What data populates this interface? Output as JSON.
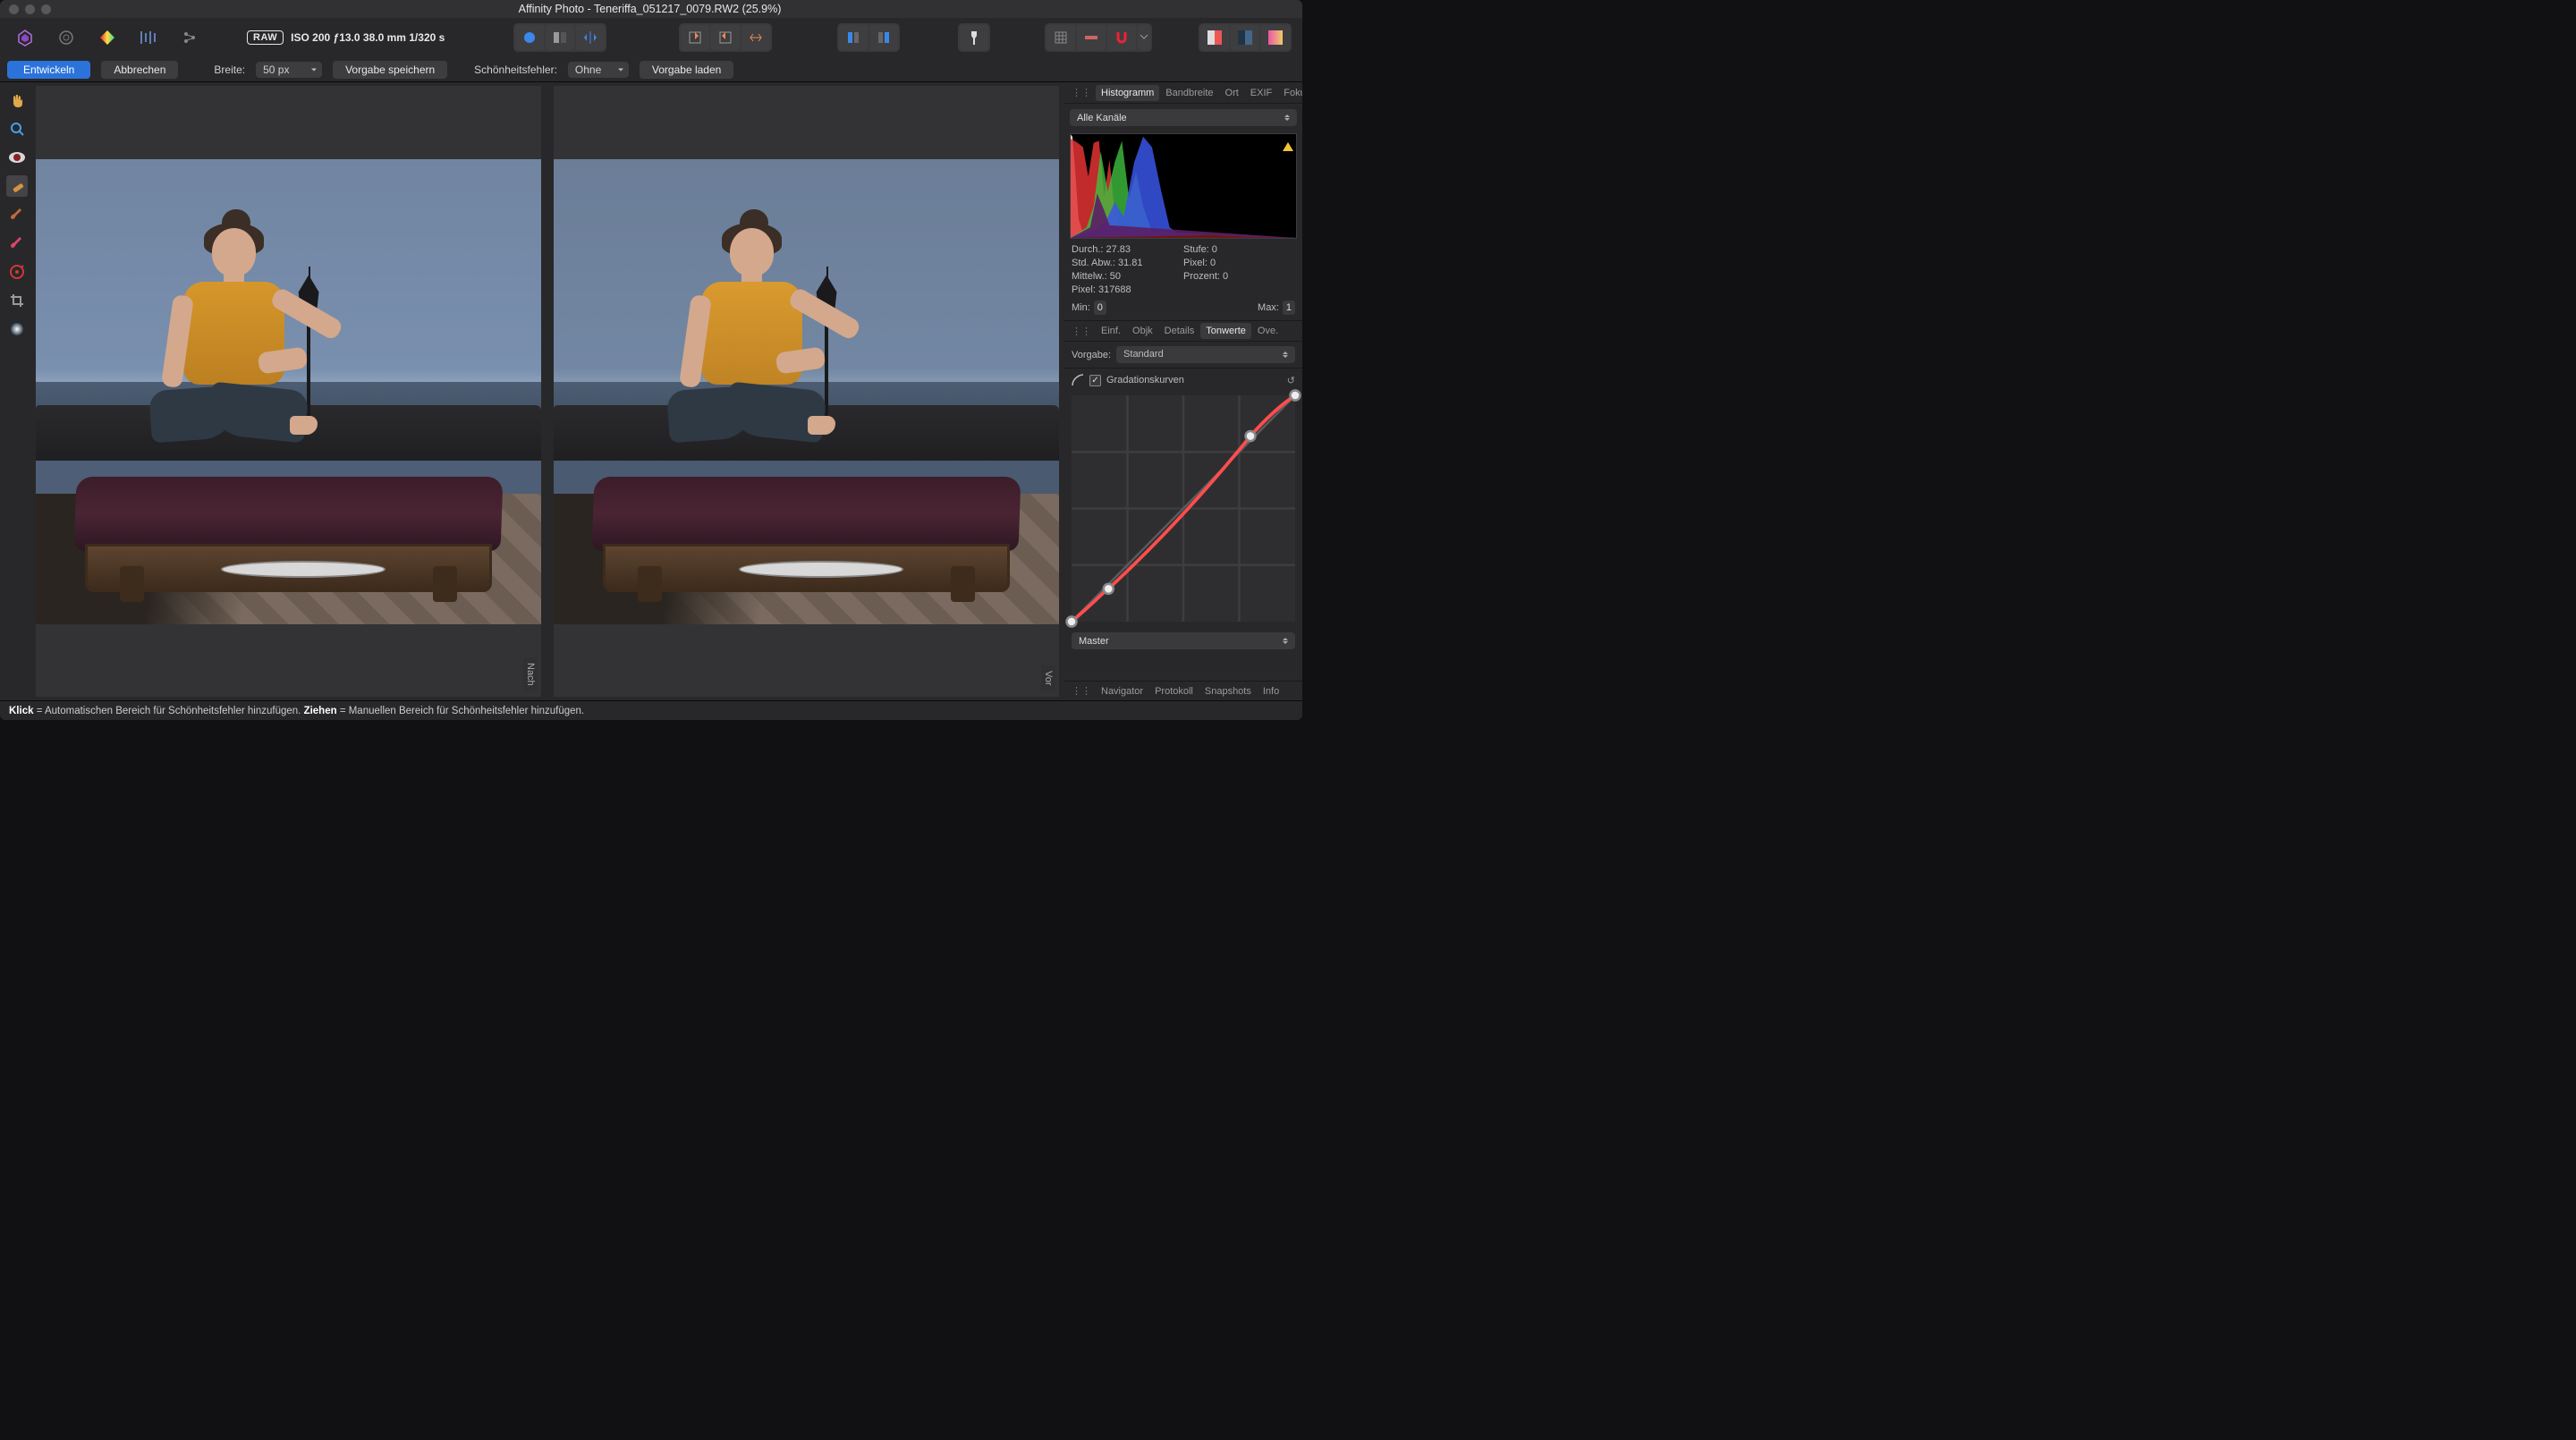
{
  "window": {
    "title": "Affinity Photo - Teneriffa_051217_0079.RW2 (25.9%)"
  },
  "toolbar": {
    "raw_tag": "RAW",
    "raw_info": "ISO 200 ƒ13.0 38.0 mm 1/320 s"
  },
  "subbar": {
    "develop": "Entwickeln",
    "cancel": "Abbrechen",
    "width_label": "Breite:",
    "width_value": "50 px",
    "save_preset": "Vorgabe speichern",
    "blemish_label": "Schönheitsfehler:",
    "blemish_value": "Ohne",
    "load_preset": "Vorgabe laden"
  },
  "views": {
    "left_tag": "Nach",
    "right_tag": "Vor"
  },
  "right_panel": {
    "tabs1": [
      "Histogramm",
      "Bandbreite",
      "Ort",
      "EXIF",
      "Fokus"
    ],
    "tabs1_active": 0,
    "channel": "Alle Kanäle",
    "stats": {
      "durch": "Durch.: 27.83",
      "std": "Std. Abw.: 31.81",
      "mittel": "Mittelw.: 50",
      "pixeln": "Pixel: 317688",
      "stufe": "Stufe: 0",
      "pixel0": "Pixel: 0",
      "prozent": "Prozent: 0"
    },
    "min_label": "Min:",
    "min_val": "0",
    "max_label": "Max:",
    "max_val": "1",
    "tabs2": [
      "Einf.",
      "Objk",
      "Details",
      "Tonwerte",
      "Ove."
    ],
    "tabs2_active": 3,
    "preset_label": "Vorgabe:",
    "preset_value": "Standard",
    "curves_label": "Gradationskurven",
    "master": "Master",
    "tabs3": [
      "Navigator",
      "Protokoll",
      "Snapshots",
      "Info"
    ]
  },
  "status": {
    "k1": "Klick",
    "t1": " = Automatischen Bereich für Schönheitsfehler hinzufügen. ",
    "k2": "Ziehen",
    "t2": " = Manuellen Bereich für Schönheitsfehler hinzufügen."
  },
  "chart_data": {
    "histogram": {
      "type": "area",
      "title": "Histogramm — Alle Kanäle",
      "xlim": [
        0,
        255
      ],
      "ylim": [
        0,
        1
      ],
      "series": [
        {
          "name": "R",
          "color": "#e33232",
          "x": [
            0,
            14,
            22,
            30,
            40,
            48,
            58,
            70,
            255
          ],
          "y": [
            0.95,
            0.88,
            0.55,
            0.92,
            0.38,
            0.72,
            0.15,
            0.03,
            0
          ]
        },
        {
          "name": "G",
          "color": "#3fbf3f",
          "x": [
            0,
            26,
            36,
            48,
            60,
            70,
            82,
            96,
            255
          ],
          "y": [
            0.12,
            0.3,
            0.82,
            0.42,
            0.94,
            0.35,
            0.6,
            0.06,
            0
          ]
        },
        {
          "name": "B",
          "color": "#3a55e6",
          "x": [
            0,
            30,
            46,
            60,
            74,
            90,
            104,
            118,
            255
          ],
          "y": [
            0.08,
            0.14,
            0.34,
            0.18,
            0.72,
            0.98,
            0.45,
            0.04,
            0
          ]
        },
        {
          "name": "L",
          "color": "#eeeeee",
          "x": [
            0,
            4,
            10,
            255
          ],
          "y": [
            0.98,
            0.6,
            0.05,
            0
          ]
        }
      ]
    },
    "curve": {
      "type": "line",
      "title": "Gradationskurven — Master",
      "xlim": [
        0,
        1
      ],
      "ylim": [
        0,
        1
      ],
      "points": [
        [
          0,
          0
        ],
        [
          0.165,
          0.145
        ],
        [
          0.8,
          0.82
        ],
        [
          1,
          1
        ]
      ]
    }
  }
}
